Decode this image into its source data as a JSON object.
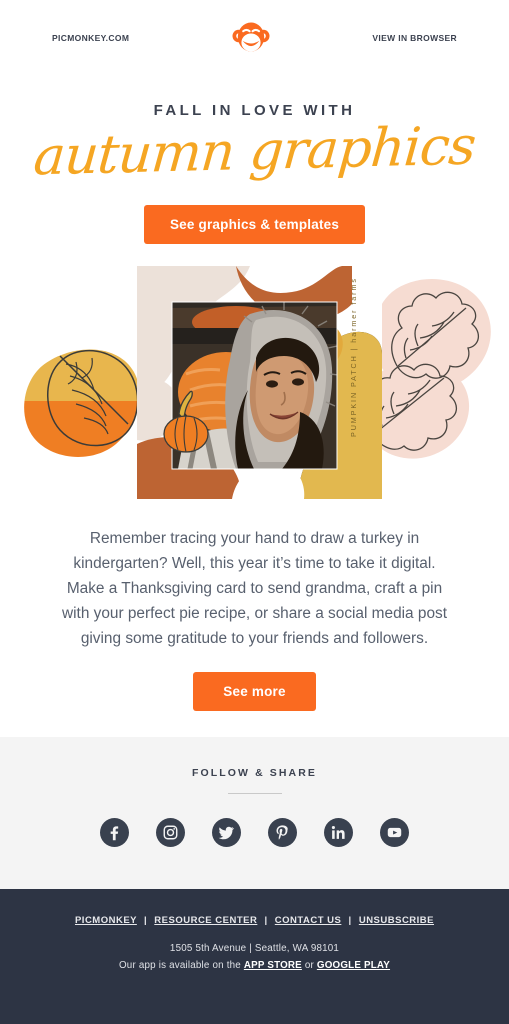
{
  "preheader": {
    "site_label": "PICMONKEY.COM",
    "browser_label": "VIEW IN BROWSER",
    "logo_icon": "picmonkey-monkey-logo"
  },
  "hero": {
    "eyebrow": "FALL IN LOVE WITH",
    "script_headline": "autumn graphics",
    "cta_label": "See graphics & templates"
  },
  "collage": {
    "card_vertical_label": "PUMPKIN PATCH | harmer farms",
    "photo_alt": "woman in fur-trimmed hood smiling at pumpkin patch",
    "elements": [
      "yellow-orange-leaf-left",
      "blush-oak-leaves-right",
      "orange-pumpkin-illustration",
      "rust-blob",
      "beige-blob",
      "gold-panel"
    ]
  },
  "body": {
    "paragraph": "Remember tracing your hand to draw a turkey in kindergarten? Well, this year it’s time to take it digital. Make a Thanksgiving card to send grandma, craft a pin with your perfect pie recipe, or share a social media post giving some gratitude to your friends and followers.",
    "cta_label": "See more"
  },
  "social": {
    "title": "FOLLOW & SHARE",
    "icons": [
      {
        "name": "facebook-icon",
        "label": "Facebook"
      },
      {
        "name": "instagram-icon",
        "label": "Instagram"
      },
      {
        "name": "twitter-icon",
        "label": "Twitter"
      },
      {
        "name": "pinterest-icon",
        "label": "Pinterest"
      },
      {
        "name": "linkedin-icon",
        "label": "LinkedIn"
      },
      {
        "name": "youtube-icon",
        "label": "YouTube"
      }
    ]
  },
  "footer": {
    "links": [
      "PICMONKEY",
      "RESOURCE CENTER",
      "CONTACT US",
      "UNSUBSCRIBE"
    ],
    "separator": "|",
    "address": "1505 5th Avenue  |  Seattle, WA 98101",
    "app_prefix": "Our app is available on the ",
    "app_store": "APP STORE",
    "app_join": " or ",
    "google_play": "GOOGLE PLAY"
  },
  "colors": {
    "brand_orange": "#fa6a20",
    "script_gold": "#f5a623",
    "ink": "#3c4250",
    "body_text": "#58606e",
    "band_gray": "#f4f4f4",
    "footer_navy": "#2d3444",
    "rust": "#bd6433",
    "gold_panel": "#e0b council"
  }
}
